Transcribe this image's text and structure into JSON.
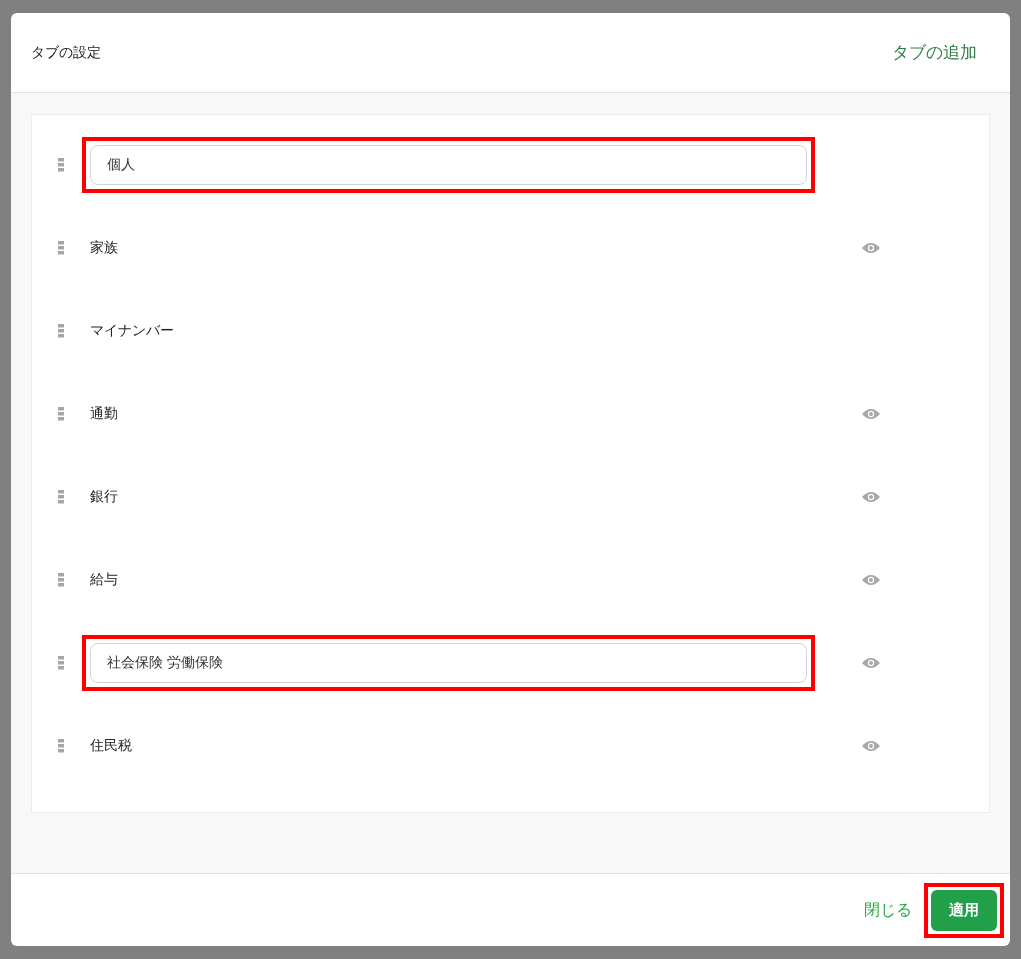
{
  "dialog": {
    "title": "タブの設定",
    "add_tab_link": "タブの追加"
  },
  "tabs": [
    {
      "kind": "input",
      "label": "個人",
      "highlighted": true,
      "eye": false
    },
    {
      "kind": "text",
      "label": "家族",
      "highlighted": false,
      "eye": true
    },
    {
      "kind": "text",
      "label": "マイナンバー",
      "highlighted": false,
      "eye": false
    },
    {
      "kind": "text",
      "label": "通勤",
      "highlighted": false,
      "eye": true
    },
    {
      "kind": "text",
      "label": "銀行",
      "highlighted": false,
      "eye": true
    },
    {
      "kind": "text",
      "label": "給与",
      "highlighted": false,
      "eye": true
    },
    {
      "kind": "input",
      "label": "社会保険 労働保険",
      "highlighted": true,
      "eye": true
    },
    {
      "kind": "text",
      "label": "住民税",
      "highlighted": false,
      "eye": true
    }
  ],
  "footer": {
    "close": "閉じる",
    "apply": {
      "label": "適用",
      "highlighted": true
    }
  }
}
